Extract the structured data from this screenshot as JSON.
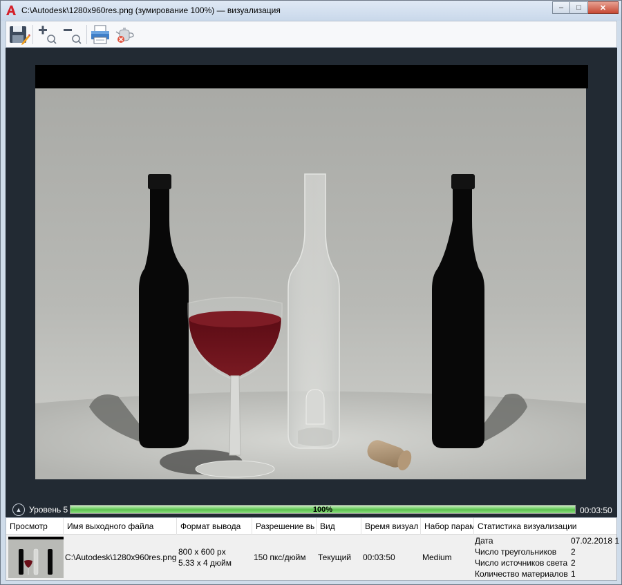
{
  "window": {
    "title": "C:\\Autodesk\\1280x960res.png (зумирование 100%) — визуализация",
    "minimize": "–",
    "maximize": "□",
    "close": "✕"
  },
  "toolbar": {
    "save": "save-icon",
    "zoom_in": "zoom-in-icon",
    "zoom_out": "zoom-out-icon",
    "print": "print-icon",
    "cancel_render": "cancel-render-teapot-icon"
  },
  "status": {
    "level": "Уровень 5",
    "progress": 100,
    "progress_label": "100%",
    "elapsed": "00:03:50"
  },
  "history": {
    "columns": [
      "Просмотр",
      "Имя выходного файла",
      "Формат вывода",
      "Разрешение вь",
      "Вид",
      "Время визуал",
      "Набор парам",
      "Статистика визуализации"
    ],
    "row": {
      "filename": "C:\\Autodesk\\1280x960res.png",
      "format_px": "800 x 600 px",
      "format_in": "5.33 x 4 дюйм",
      "resolution": "150 пкс/дюйм",
      "view": "Текущий",
      "time": "00:03:50",
      "preset": "Medium",
      "stats": [
        {
          "label": "Дата",
          "value": "07.02.2018 1"
        },
        {
          "label": "Число треугольников",
          "value": "2"
        },
        {
          "label": "Число источников света",
          "value": "2"
        },
        {
          "label": "Количество материалов",
          "value": "1"
        }
      ]
    }
  },
  "colors": {
    "accent": "#2a7de1",
    "progress_green": "#5ac24c",
    "wine": "#6a0f18",
    "render_bg": "#222a33"
  }
}
